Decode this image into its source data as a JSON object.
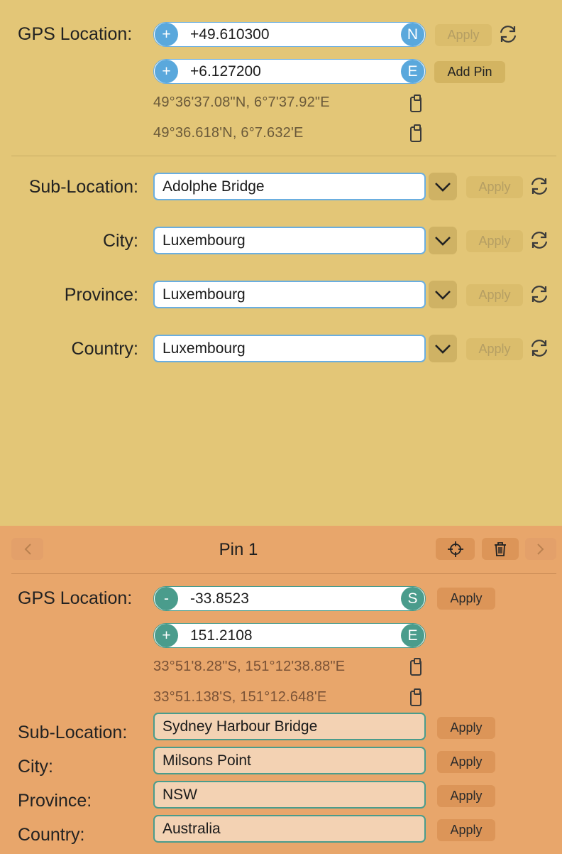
{
  "top": {
    "gps_label": "GPS Location:",
    "lat": {
      "sign": "+",
      "value": "+49.610300",
      "dir": "N"
    },
    "lon": {
      "sign": "+",
      "value": "+6.127200",
      "dir": "E"
    },
    "apply_label": "Apply",
    "add_pin_label": "Add Pin",
    "dms": "49°36'37.08\"N, 6°7'37.92\"E",
    "dm": "49°36.618'N, 6°7.632'E",
    "fields": [
      {
        "label": "Sub-Location:",
        "value": "Adolphe Bridge",
        "apply": "Apply"
      },
      {
        "label": "City:",
        "value": "Luxembourg",
        "apply": "Apply"
      },
      {
        "label": "Province:",
        "value": "Luxembourg",
        "apply": "Apply"
      },
      {
        "label": "Country:",
        "value": "Luxembourg",
        "apply": "Apply"
      }
    ]
  },
  "pin": {
    "title": "Pin 1",
    "gps_label": "GPS Location:",
    "lat": {
      "sign": "-",
      "value": "-33.8523",
      "dir": "S"
    },
    "lon": {
      "sign": "+",
      "value": "151.2108",
      "dir": "E"
    },
    "apply_label": "Apply",
    "dms": "33°51'8.28\"S, 151°12'38.88\"E",
    "dm": "33°51.138'S, 151°12.648'E",
    "fields": [
      {
        "label": "Sub-Location:",
        "value": "Sydney Harbour Bridge",
        "apply": "Apply"
      },
      {
        "label": "City:",
        "value": "Milsons Point",
        "apply": "Apply"
      },
      {
        "label": "Province:",
        "value": "NSW",
        "apply": "Apply"
      },
      {
        "label": "Country:",
        "value": "Australia",
        "apply": "Apply"
      }
    ]
  },
  "colors": {
    "top_bg": "#e3c677",
    "bottom_bg": "#e8a66b",
    "blue_accent": "#5aa8dc",
    "teal_accent": "#4a9c8c"
  }
}
